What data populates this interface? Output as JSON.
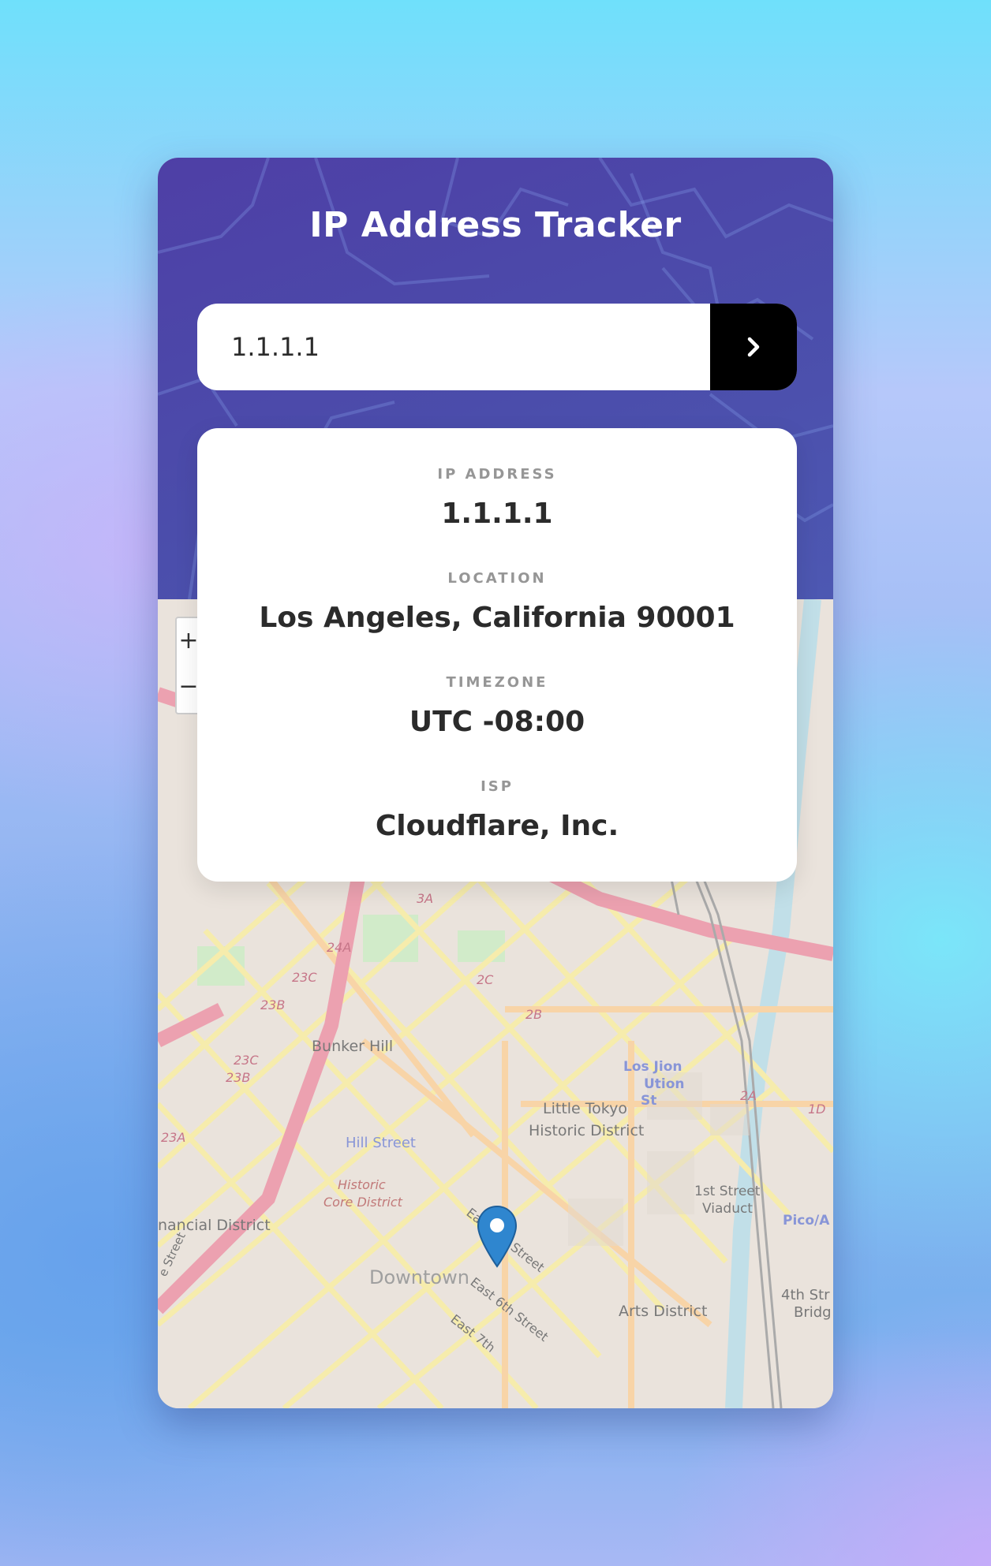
{
  "header": {
    "title": "IP Address Tracker"
  },
  "search": {
    "value": "1.1.1.1",
    "submit_icon": "chevron-right-icon"
  },
  "info": {
    "ip_label": "IP ADDRESS",
    "ip_value": "1.1.1.1",
    "location_label": "LOCATION",
    "location_value": "Los Angeles, California 90001",
    "timezone_label": "TIMEZONE",
    "timezone_value": "UTC -08:00",
    "isp_label": "ISP",
    "isp_value": "Cloudflare, Inc."
  },
  "map": {
    "zoom_in": "+",
    "zoom_out": "−",
    "labels": {
      "bunker_hill": "Bunker Hill",
      "little_tokyo_1": "Little Tokyo",
      "little_tokyo_2": "Historic District",
      "hill_street": "Hill Street",
      "historic_core_1": "Historic",
      "historic_core_2": "Core District",
      "financial": "nancial District",
      "downtown": "Downtown",
      "east_4th": "East 4th Street",
      "east_6th": "East 6th Street",
      "east_7th": "East 7th",
      "arts": "Arts District",
      "first_street_1": "1st Street",
      "first_street_2": "Viaduct",
      "union_1": "Los  Jion",
      "union_2": "Ution",
      "union_3": "St",
      "pico": "Pico/A",
      "fourth_1": "4th Str",
      "fourth_2": "Bridg",
      "side_street": "e Street",
      "r_3a": "3A",
      "r_24a": "24A",
      "r_23c": "23C",
      "r_23b": "23B",
      "r_2c": "2C",
      "r_2b": "2B",
      "r_2a": "2A",
      "r_1d": "1D",
      "r_23c2": "23C",
      "r_23b2": "23B",
      "r_23a": "23A"
    },
    "marker_icon": "map-pin-icon"
  },
  "colors": {
    "header": "#4b4dab",
    "accent": "#000000",
    "text": "#2b2b2b",
    "label": "#969696"
  }
}
